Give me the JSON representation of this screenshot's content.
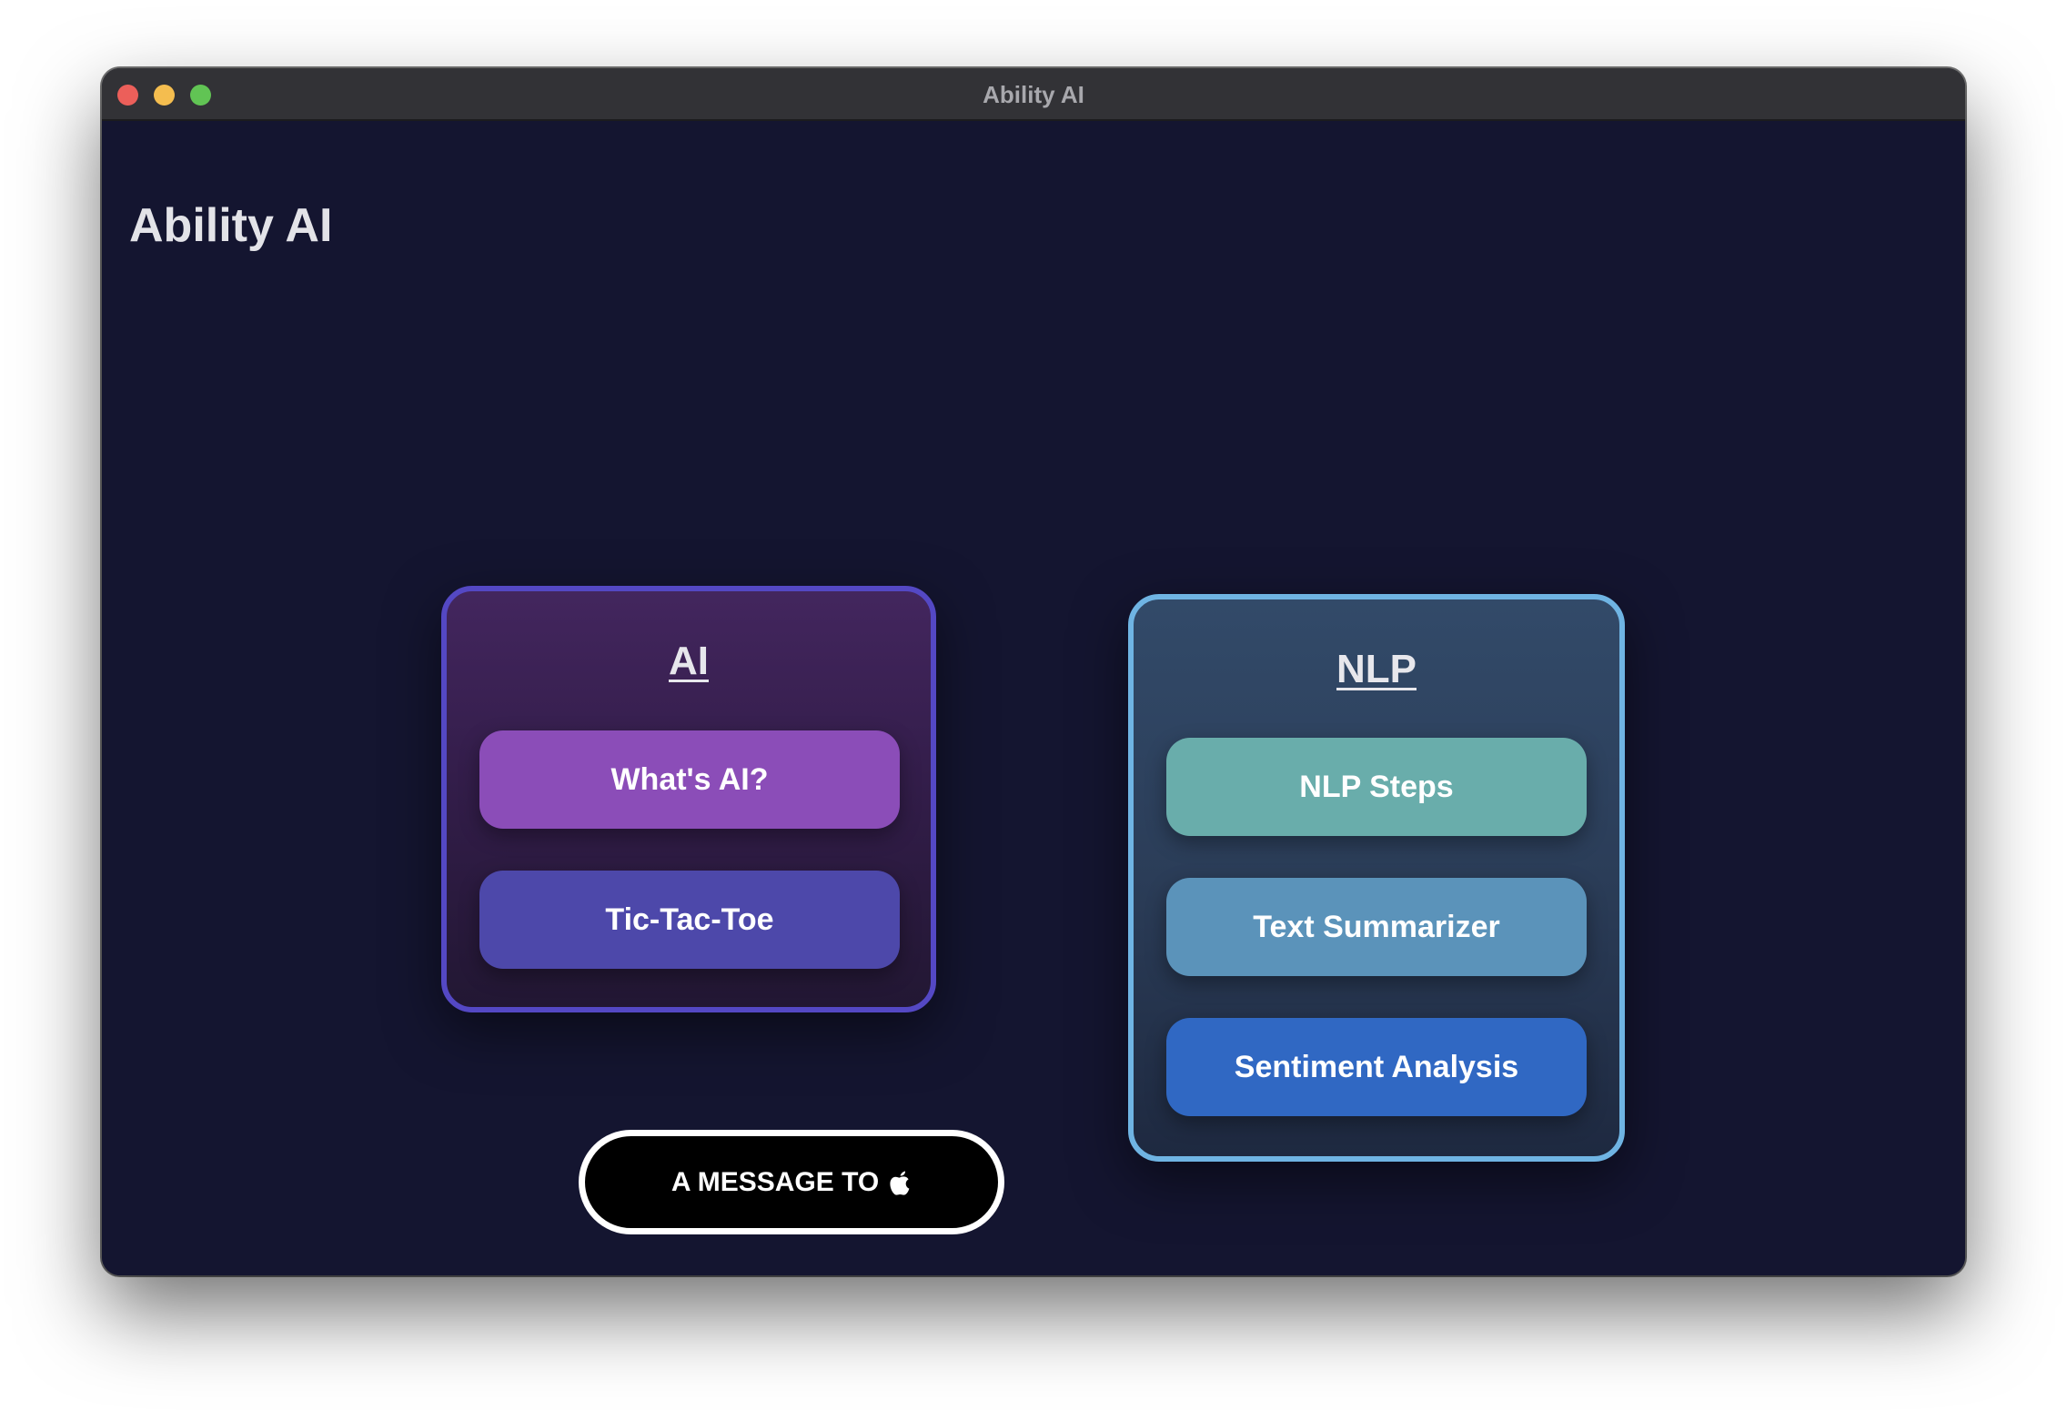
{
  "window": {
    "title": "Ability AI"
  },
  "app": {
    "heading": "Ability AI"
  },
  "ai_card": {
    "title": "AI",
    "buttons": [
      {
        "label": "What's AI?"
      },
      {
        "label": "Tic-Tac-Toe"
      }
    ]
  },
  "nlp_card": {
    "title": "NLP",
    "buttons": [
      {
        "label": "NLP Steps"
      },
      {
        "label": "Text Summarizer"
      },
      {
        "label": "Sentiment Analysis"
      }
    ]
  },
  "message_button": {
    "label": "A MESSAGE TO",
    "icon": "apple-logo-icon"
  },
  "colors": {
    "background": "#141530",
    "ai_border": "#5448c4",
    "nlp_border": "#6fb4e3",
    "whats_ai": "#8b4db8",
    "tic_tac_toe": "#4d48aa",
    "nlp_steps": "#69adab",
    "text_summarizer": "#5b93ba",
    "sentiment_analysis": "#3068c3"
  }
}
